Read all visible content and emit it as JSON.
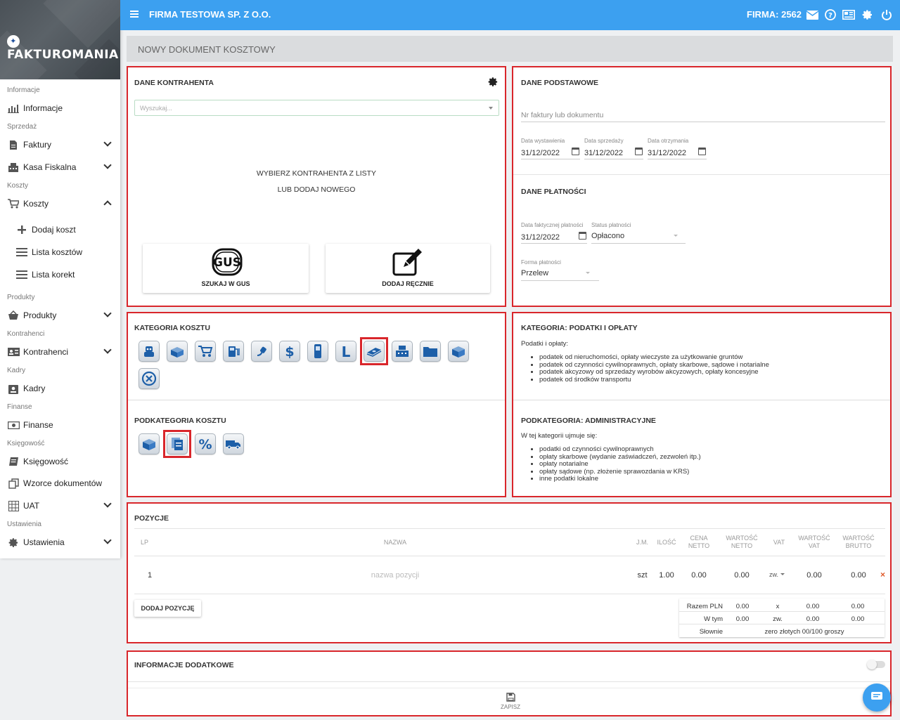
{
  "app": {
    "logo_text": "FAKTUROMANIA",
    "company": "FIRMA TESTOWA SP. Z O.O.",
    "firma_label": "FIRMA: 2562"
  },
  "sidebar": {
    "sections": [
      "Informacje",
      "Sprzedaż",
      "Koszty",
      "Produkty",
      "Kontrahenci",
      "Kadry",
      "Finanse",
      "Księgowość",
      "Ustawienia"
    ],
    "items": [
      "Informacje",
      "Faktury",
      "Kasa Fiskalna",
      "Koszty",
      "Dodaj koszt",
      "Lista kosztów",
      "Lista korekt",
      "Produkty",
      "Kontrahenci",
      "Kadry",
      "Finanse",
      "Księgowość",
      "Wzorce dokumentów",
      "UAT",
      "Ustawienia"
    ]
  },
  "page": {
    "title": "NOWY DOKUMENT KOSZTOWY"
  },
  "kontrahent": {
    "title": "DANE KONTRAHENTA",
    "search_placeholder": "Wyszukaj...",
    "prompt_line1": "WYBIERZ KONTRAHENTA Z LISTY",
    "prompt_line2": "LUB DODAJ NOWEGO",
    "gus_logo": "GUS",
    "gus_button": "SZUKAJ W GUS",
    "manual_button": "DODAJ RĘCZNIE"
  },
  "podstawowe": {
    "title": "DANE PODSTAWOWE",
    "invoice_placeholder": "Nr faktury lub dokumentu",
    "date_issue_label": "Data wystawienia",
    "date_issue": "31/12/2022",
    "date_sale_label": "Data sprzedaży",
    "date_sale": "31/12/2022",
    "date_receipt_label": "Data otrzymania",
    "date_receipt": "31/12/2022"
  },
  "platnosci": {
    "title": "DANE PŁATNOŚCI",
    "paid_date_label": "Data faktycznej płatności",
    "paid_date": "31/12/2022",
    "status_label": "Status płatności",
    "status": "Opłacono",
    "method_label": "Forma płatności",
    "method": "Przelew"
  },
  "kategoria": {
    "title": "KATEGORIA KOSZTU",
    "icons": [
      "robot-icon",
      "box-icon",
      "cart-icon",
      "fuel-icon",
      "plug-icon",
      "dollar-icon",
      "phone-icon",
      "l-icon",
      "money-stack-icon",
      "cash-register-icon",
      "folder-icon",
      "package-icon",
      "cancel-icon"
    ],
    "selected_index": 8
  },
  "kategoria_info": {
    "title": "KATEGORIA: PODATKI I OPŁATY",
    "intro": "Podatki i opłaty:",
    "bullets": [
      "podatek od nieruchomości, opłaty wieczyste za użytkowanie gruntów",
      "podatek od czynności cywilnoprawnych, opłaty skarbowe, sądowe i notarialne",
      "podatek akcyzowy od sprzedaży wyrobów akcyzowych, opłaty koncesyjne",
      "podatek od środków transportu"
    ]
  },
  "podkategoria": {
    "title": "PODKATEGORIA KOSZTU",
    "icons": [
      "package-icon",
      "documents-icon",
      "percent-icon",
      "truck-icon"
    ],
    "selected_index": 1
  },
  "podkategoria_info": {
    "title": "PODKATEGORIA: ADMINISTRACYJNE",
    "intro": "W tej kategorii ujmuje się:",
    "bullets": [
      "podatki od czynności cywilnoprawnych",
      "opłaty skarbowe (wydanie zaświadczeń, zezwoleń itp.)",
      "opłaty notarialne",
      "opłaty sądowe (np. złożenie sprawozdania w KRS)",
      "inne podatki lokalne"
    ]
  },
  "pozycje": {
    "title": "POZYCJE",
    "headers": {
      "lp": "LP",
      "nazwa": "NAZWA",
      "jm": "J.M.",
      "ilosc": "ILOŚĆ",
      "cena1": "CENA",
      "cena2": "NETTO",
      "wn1": "WARTOŚĆ",
      "wn2": "NETTO",
      "vat": "VAT",
      "wv1": "WARTOŚĆ",
      "wv2": "VAT",
      "wb1": "WARTOŚĆ",
      "wb2": "BRUTTO"
    },
    "row": {
      "lp": "1",
      "nazwa_placeholder": "nazwa pozycji",
      "jm": "szt",
      "ilosc": "1.00",
      "cena": "0.00",
      "netto": "0.00",
      "vat": "zw.",
      "wartosc_vat": "0.00",
      "brutto": "0.00",
      "remove": "×"
    },
    "add_button": "DODAJ POZYCJĘ",
    "summary": {
      "razem_label": "Razem PLN",
      "razem_netto": "0.00",
      "razem_vat_rate": "x",
      "razem_vat": "0.00",
      "razem_brutto": "0.00",
      "wtym_label": "W tym",
      "wtym_netto": "0.00",
      "wtym_rate": "zw.",
      "wtym_vat": "0.00",
      "wtym_brutto": "0.00",
      "slownie_label": "Słownie",
      "slownie": "zero złotych 00/100 groszy"
    }
  },
  "dodatkowe": {
    "title": "INFORMACJE DODATKOWE",
    "save_label": "ZAPISZ"
  }
}
